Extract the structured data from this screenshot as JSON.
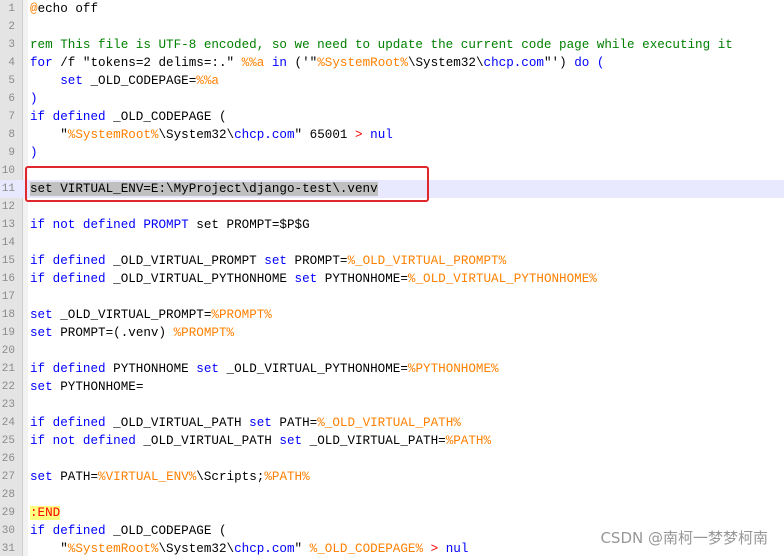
{
  "lines": [
    {
      "n": "1",
      "t": [
        {
          "c": "lbl2",
          "v": "@"
        },
        {
          "c": "",
          "v": "echo off"
        }
      ]
    },
    {
      "n": "2",
      "t": []
    },
    {
      "n": "3",
      "t": [
        {
          "c": "cm",
          "v": "rem This file is UTF-8 encoded, so we need to update the current code page while executing it"
        }
      ]
    },
    {
      "n": "4",
      "t": [
        {
          "c": "kw",
          "v": "for"
        },
        {
          "c": "",
          "v": " /f \"tokens=2 delims=:.\" "
        },
        {
          "c": "var",
          "v": "%%a"
        },
        {
          "c": "",
          "v": " "
        },
        {
          "c": "kw",
          "v": "in"
        },
        {
          "c": "",
          "v": " ('\""
        },
        {
          "c": "var",
          "v": "%SystemRoot%"
        },
        {
          "c": "",
          "v": "\\System32\\"
        },
        {
          "c": "cmd",
          "v": "chcp.com"
        },
        {
          "c": "",
          "v": "\"') "
        },
        {
          "c": "kw",
          "v": "do"
        },
        {
          "c": "",
          "v": " "
        },
        {
          "c": "kw",
          "v": "("
        }
      ]
    },
    {
      "n": "5",
      "t": [
        {
          "c": "",
          "v": "    "
        },
        {
          "c": "kw",
          "v": "set"
        },
        {
          "c": "",
          "v": " _OLD_CODEPAGE="
        },
        {
          "c": "var",
          "v": "%%a"
        }
      ]
    },
    {
      "n": "6",
      "t": [
        {
          "c": "kw",
          "v": ")"
        }
      ]
    },
    {
      "n": "7",
      "t": [
        {
          "c": "kw",
          "v": "if defined"
        },
        {
          "c": "",
          "v": " _OLD_CODEPAGE ("
        }
      ]
    },
    {
      "n": "8",
      "t": [
        {
          "c": "",
          "v": "    \""
        },
        {
          "c": "var",
          "v": "%SystemRoot%"
        },
        {
          "c": "",
          "v": "\\System32\\"
        },
        {
          "c": "cmd",
          "v": "chcp.com"
        },
        {
          "c": "",
          "v": "\" 65001 "
        },
        {
          "c": "op",
          "v": ">"
        },
        {
          "c": "",
          "v": " "
        },
        {
          "c": "kw",
          "v": "nul"
        }
      ]
    },
    {
      "n": "9",
      "t": [
        {
          "c": "kw",
          "v": ")"
        }
      ]
    },
    {
      "n": "10",
      "t": []
    },
    {
      "n": "11",
      "cur": true,
      "t": [
        {
          "c": "sel kw",
          "v": "set"
        },
        {
          "c": "sel",
          "v": " VIRTUAL_ENV=E:\\MyProject\\django-test\\.venv"
        }
      ]
    },
    {
      "n": "12",
      "t": []
    },
    {
      "n": "13",
      "t": [
        {
          "c": "kw",
          "v": "if not defined"
        },
        {
          "c": "",
          "v": " "
        },
        {
          "c": "kw",
          "v": "PROMPT"
        },
        {
          "c": "",
          "v": " set PROMPT=$P$G"
        }
      ]
    },
    {
      "n": "14",
      "t": []
    },
    {
      "n": "15",
      "t": [
        {
          "c": "kw",
          "v": "if defined"
        },
        {
          "c": "",
          "v": " _OLD_VIRTUAL_PROMPT "
        },
        {
          "c": "kw",
          "v": "set"
        },
        {
          "c": "",
          "v": " PROMPT="
        },
        {
          "c": "var",
          "v": "%_OLD_VIRTUAL_PROMPT%"
        }
      ]
    },
    {
      "n": "16",
      "t": [
        {
          "c": "kw",
          "v": "if defined"
        },
        {
          "c": "",
          "v": " _OLD_VIRTUAL_PYTHONHOME "
        },
        {
          "c": "kw",
          "v": "set"
        },
        {
          "c": "",
          "v": " PYTHONHOME="
        },
        {
          "c": "var",
          "v": "%_OLD_VIRTUAL_PYTHONHOME%"
        }
      ]
    },
    {
      "n": "17",
      "t": []
    },
    {
      "n": "18",
      "t": [
        {
          "c": "kw",
          "v": "set"
        },
        {
          "c": "",
          "v": " _OLD_VIRTUAL_PROMPT="
        },
        {
          "c": "var",
          "v": "%PROMPT%"
        }
      ]
    },
    {
      "n": "19",
      "t": [
        {
          "c": "kw",
          "v": "set"
        },
        {
          "c": "",
          "v": " PROMPT=(.venv) "
        },
        {
          "c": "var",
          "v": "%PROMPT%"
        }
      ]
    },
    {
      "n": "20",
      "t": []
    },
    {
      "n": "21",
      "t": [
        {
          "c": "kw",
          "v": "if defined"
        },
        {
          "c": "",
          "v": " PYTHONHOME "
        },
        {
          "c": "kw",
          "v": "set"
        },
        {
          "c": "",
          "v": " _OLD_VIRTUAL_PYTHONHOME="
        },
        {
          "c": "var",
          "v": "%PYTHONHOME%"
        }
      ]
    },
    {
      "n": "22",
      "t": [
        {
          "c": "kw",
          "v": "set"
        },
        {
          "c": "",
          "v": " PYTHONHOME="
        }
      ]
    },
    {
      "n": "23",
      "t": []
    },
    {
      "n": "24",
      "t": [
        {
          "c": "kw",
          "v": "if defined"
        },
        {
          "c": "",
          "v": " _OLD_VIRTUAL_PATH "
        },
        {
          "c": "kw",
          "v": "set"
        },
        {
          "c": "",
          "v": " PATH="
        },
        {
          "c": "var",
          "v": "%_OLD_VIRTUAL_PATH%"
        }
      ]
    },
    {
      "n": "25",
      "t": [
        {
          "c": "kw",
          "v": "if not defined"
        },
        {
          "c": "",
          "v": " _OLD_VIRTUAL_PATH "
        },
        {
          "c": "kw",
          "v": "set"
        },
        {
          "c": "",
          "v": " _OLD_VIRTUAL_PATH="
        },
        {
          "c": "var",
          "v": "%PATH%"
        }
      ]
    },
    {
      "n": "26",
      "t": []
    },
    {
      "n": "27",
      "t": [
        {
          "c": "kw",
          "v": "set"
        },
        {
          "c": "",
          "v": " PATH="
        },
        {
          "c": "var",
          "v": "%VIRTUAL_ENV%"
        },
        {
          "c": "",
          "v": "\\Scripts;"
        },
        {
          "c": "var",
          "v": "%PATH%"
        }
      ]
    },
    {
      "n": "28",
      "t": []
    },
    {
      "n": "29",
      "t": [
        {
          "c": "lbl",
          "v": ":END"
        }
      ]
    },
    {
      "n": "30",
      "t": [
        {
          "c": "kw",
          "v": "if defined"
        },
        {
          "c": "",
          "v": " _OLD_CODEPAGE ("
        }
      ]
    },
    {
      "n": "31",
      "t": [
        {
          "c": "",
          "v": "    \""
        },
        {
          "c": "var",
          "v": "%SystemRoot%"
        },
        {
          "c": "",
          "v": "\\System32\\"
        },
        {
          "c": "cmd",
          "v": "chcp.com"
        },
        {
          "c": "",
          "v": "\" "
        },
        {
          "c": "var",
          "v": "%_OLD_CODEPAGE%"
        },
        {
          "c": "",
          "v": " "
        },
        {
          "c": "op",
          "v": ">"
        },
        {
          "c": "",
          "v": " "
        },
        {
          "c": "kw",
          "v": "nul"
        }
      ]
    }
  ],
  "watermark": "CSDN @南柯一梦梦柯南",
  "colors": {
    "keyword": "#0000ff",
    "variable": "#ff8000",
    "comment": "#008000",
    "operator": "#ff0000",
    "highlight_box": "#e0282c"
  }
}
